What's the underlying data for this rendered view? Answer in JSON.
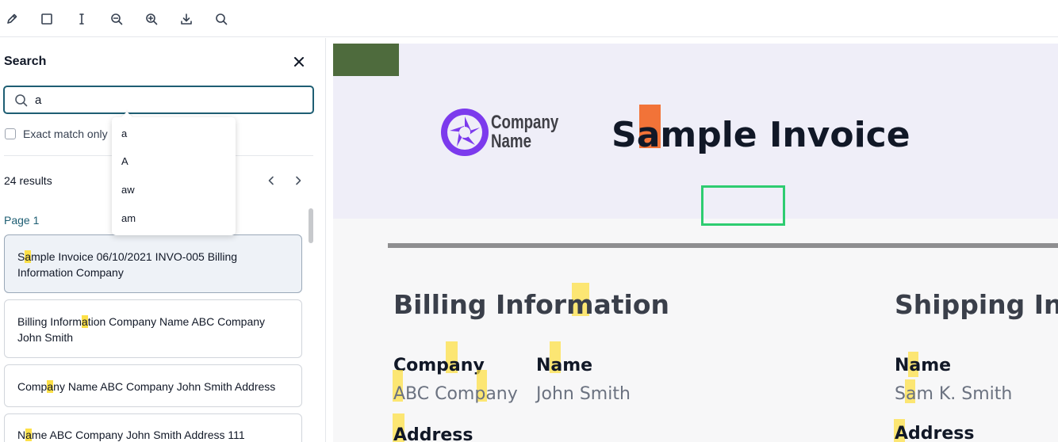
{
  "toolbar": {
    "tools": [
      "pen-icon",
      "rectangle-icon",
      "text-cursor-icon",
      "zoom-out-icon",
      "zoom-in-icon",
      "download-icon",
      "search-icon"
    ]
  },
  "search_panel": {
    "title": "Search",
    "query": "a",
    "exact_match_label": "Exact match only",
    "results_count": "24 results",
    "page_label": "Page 1",
    "suggestions": [
      "a",
      "A",
      "aw",
      "am"
    ],
    "results": [
      {
        "before": "S",
        "match": "a",
        "after": "mple Invoice 06/10/2021 INVO-005 Billing Information Company"
      },
      {
        "before": "Billing Inform",
        "match": "a",
        "after": "tion Company Name ABC Company John Smith"
      },
      {
        "before": "Comp",
        "match": "a",
        "after": "ny Name ABC Company John Smith Address"
      },
      {
        "before": "N",
        "match": "a",
        "after": "me ABC Company John Smith Address 111"
      }
    ]
  },
  "document": {
    "logo_text_line1": "Company",
    "logo_text_line2": "Name",
    "title": "Sample Invoice",
    "billing_heading": "Billing Information",
    "shipping_heading": "Shipping Info",
    "billing": {
      "company_label": "Company",
      "company_value": "ABC Company",
      "name_label": "Name",
      "name_value": "John Smith",
      "address_label": "Address"
    },
    "shipping": {
      "name_label": "Name",
      "name_value": "Sam K. Smith",
      "address_label": "Address"
    }
  },
  "colors": {
    "accent": "#1e5e73",
    "highlight": "#fde047",
    "current_match": "#f26522",
    "header_band": "#efeef8",
    "logo_purple": "#7c3aed"
  }
}
